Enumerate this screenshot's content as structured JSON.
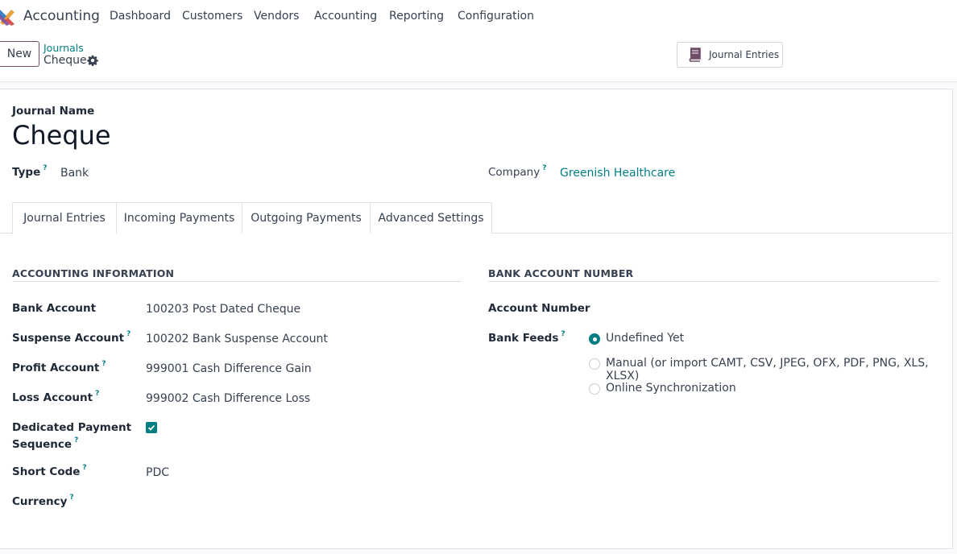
{
  "app": {
    "name": "Accounting",
    "menu": [
      "Dashboard",
      "Customers",
      "Vendors",
      "Accounting",
      "Reporting",
      "Configuration"
    ]
  },
  "control_panel": {
    "new_label": "New",
    "breadcrumb_parent": "Journals",
    "breadcrumb_current": "Cheque",
    "smart_button_label": "Journal Entries"
  },
  "form": {
    "journal_name_label": "Journal Name",
    "journal_name": "Cheque",
    "type_label": "Type",
    "type_value": "Bank",
    "company_label": "Company",
    "company_value": "Greenish Healthcare",
    "help_mark": "?"
  },
  "tabs": [
    "Journal Entries",
    "Incoming Payments",
    "Outgoing Payments",
    "Advanced Settings"
  ],
  "accounting_info": {
    "title": "ACCOUNTING INFORMATION",
    "fields": [
      {
        "label": "Bank Account",
        "value": "100203 Post Dated Cheque",
        "help": false
      },
      {
        "label": "Suspense Account",
        "value": "100202 Bank Suspense Account",
        "help": true
      },
      {
        "label": "Profit Account",
        "value": "999001 Cash Difference Gain",
        "help": true
      },
      {
        "label": "Loss Account",
        "value": "999002 Cash Difference Loss",
        "help": true
      }
    ],
    "dedicated_line1": "Dedicated Payment",
    "dedicated_line2": "Sequence",
    "dedicated_checked": true,
    "short_code_label": "Short Code",
    "short_code_value": "PDC",
    "currency_label": "Currency"
  },
  "bank_account": {
    "title": "BANK ACCOUNT NUMBER",
    "account_number_label": "Account Number",
    "bank_feeds_label": "Bank Feeds",
    "options": [
      {
        "label": "Undefined Yet",
        "checked": true
      },
      {
        "label": "Manual (or import CAMT, CSV, JPEG, OFX, PDF, PNG, XLS, XLSX)",
        "checked": false
      },
      {
        "label": "Online Synchronization",
        "checked": false
      }
    ]
  },
  "colors": {
    "accent": "#017e84",
    "brand": "#714b67"
  }
}
